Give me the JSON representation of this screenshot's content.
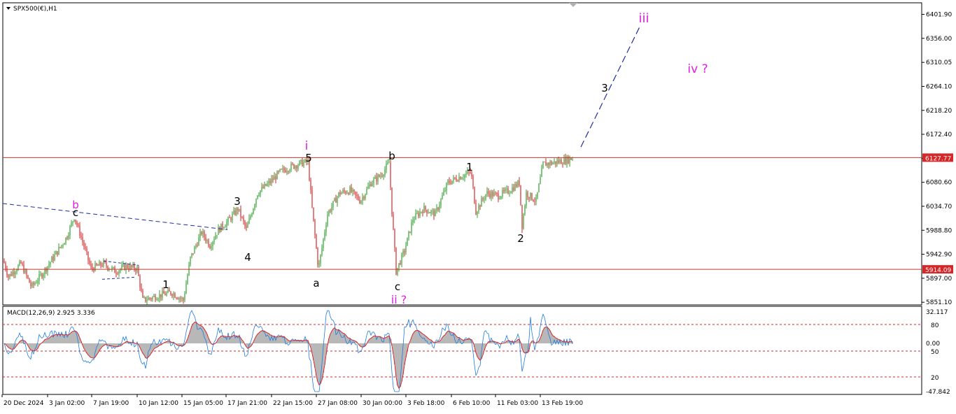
{
  "header": {
    "symbol_label": "SPX500(€),H1",
    "macd_label": "MACD(12,26,9) 2.925 3.336"
  },
  "price_axis": {
    "ticks": [
      "6401.90",
      "6356.00",
      "6310.05",
      "6264.10",
      "6218.20",
      "6172.40",
      "6126.50",
      "6080.60",
      "6034.70",
      "5988.80",
      "5942.90",
      "5897.00",
      "5851.10"
    ],
    "tick_values": [
      6401.9,
      6356.0,
      6310.05,
      6264.1,
      6218.2,
      6172.4,
      6126.5,
      6080.6,
      6034.7,
      5988.8,
      5942.9,
      5897.0,
      5851.1
    ],
    "min": 5846,
    "max": 6424,
    "current_price_label": "6127.77",
    "current_price": 6127.77,
    "support_label": "5914.09",
    "support_price": 5914.09
  },
  "macd_axis": {
    "ticks": [
      "32.117",
      "0.00",
      "-47.842"
    ],
    "level_labels": [
      "80",
      "50",
      "20"
    ]
  },
  "time_axis": [
    "20 Dec 2024",
    "3 Jan 02:00",
    "7 Jan 19:00",
    "10 Jan 12:00",
    "15 Jan 05:00",
    "17 Jan 21:00",
    "22 Jan 15:00",
    "27 Jan 08:00",
    "30 Jan 00:00",
    "3 Feb 18:00",
    "6 Feb 10:00",
    "11 Feb 03:00",
    "13 Feb 19:00"
  ],
  "wave_labels": [
    {
      "text": "b",
      "color": "#e020e0"
    },
    {
      "text": "c",
      "color": "#000000"
    },
    {
      "text": "1",
      "color": "#000000"
    },
    {
      "text": "3",
      "color": "#000000"
    },
    {
      "text": "4",
      "color": "#000000"
    },
    {
      "text": "i",
      "color": "#e020e0"
    },
    {
      "text": "5",
      "color": "#000000"
    },
    {
      "text": "a",
      "color": "#000000"
    },
    {
      "text": "b",
      "color": "#000000"
    },
    {
      "text": "c",
      "color": "#000000"
    },
    {
      "text": "ii ?",
      "color": "#e020e0"
    },
    {
      "text": "1",
      "color": "#000000"
    },
    {
      "text": "2",
      "color": "#000000"
    },
    {
      "text": "3",
      "color": "#000000"
    },
    {
      "text": "iii",
      "color": "#e020e0"
    },
    {
      "text": "iv ?",
      "color": "#e020e0"
    }
  ],
  "colors": {
    "bull": "#2ca02c",
    "bear": "#d62728",
    "resistance": "#c0392b",
    "projection": "#1f2fa0",
    "macd_line": "#1e7be0",
    "signal_line": "#d62728",
    "histogram": "#b8b8b8",
    "label_tag": "#d62728"
  },
  "chart_data": {
    "type": "line",
    "title": "SPX500(€),H1",
    "xlabel": "",
    "ylabel": "",
    "ylim": [
      5846,
      6424
    ],
    "grid": false,
    "horizontal_lines": [
      6127.77,
      5914.09
    ],
    "series": [
      {
        "name": "SPX500(€),H1",
        "x": [
          "20 Dec 2024",
          "3 Jan 02:00",
          "7 Jan 19:00",
          "10 Jan 12:00",
          "15 Jan 05:00",
          "17 Jan 21:00",
          "22 Jan 15:00",
          "27 Jan 08:00",
          "30 Jan 00:00",
          "3 Feb 18:00",
          "6 Feb 10:00",
          "11 Feb 03:00",
          "13 Feb 19:00"
        ],
        "y": [
          5910,
          6010,
          5895,
          5855,
          5985,
          6030,
          6120,
          5950,
          6105,
          5955,
          6090,
          6080,
          6124
        ]
      }
    ],
    "indicator": {
      "name": "MACD(12,26,9)",
      "macd": 2.925,
      "signal": 3.336,
      "ylim": [
        -47.842,
        32.117
      ]
    }
  }
}
